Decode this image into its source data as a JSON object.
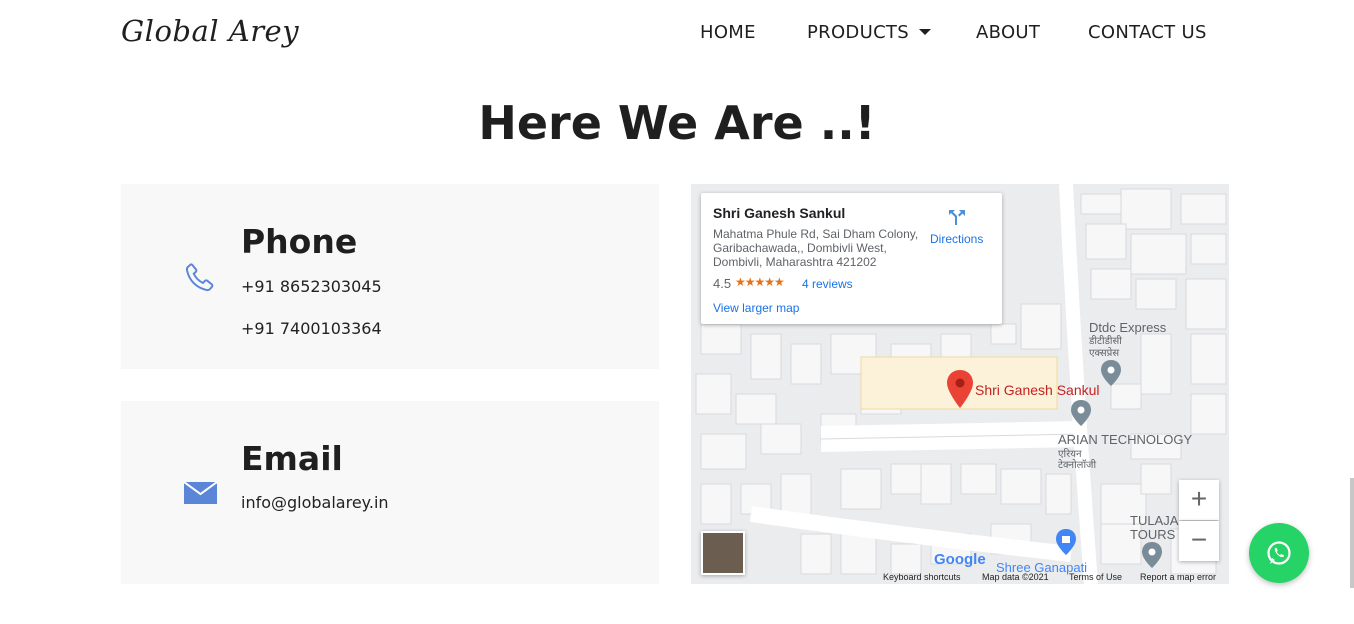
{
  "header": {
    "logo": "Global Arey",
    "nav": [
      {
        "label": "HOME"
      },
      {
        "label": "PRODUCTS"
      },
      {
        "label": "ABOUT"
      },
      {
        "label": "CONTACT US"
      }
    ]
  },
  "main": {
    "title": "Here We Are ..!",
    "phone": {
      "heading": "Phone",
      "numbers": [
        "+91 8652303045",
        "+91 7400103364"
      ],
      "icon": "phone-icon"
    },
    "email": {
      "heading": "Email",
      "address": "info@globalarey.in",
      "icon": "mail-icon"
    }
  },
  "map": {
    "place_name": "Shri Ganesh Sankul",
    "address": "Mahatma Phule Rd, Sai Dham Colony, Garibachawada,, Dombivli West, Dombivli, Maharashtra 421202",
    "rating": "4.5",
    "stars": "★★★★★",
    "reviews": "4 reviews",
    "view_larger": "View larger map",
    "directions": "Directions",
    "marker_label": "Shri Ganesh Sankul",
    "labels": {
      "dtdc": "Dtdc Express",
      "dtdc_hi1": "डीटीडीसी",
      "dtdc_hi2": "एक्सप्रेस",
      "arian": "ARIAN TECHNOLOGY",
      "arian_hi1": "एरियन",
      "arian_hi2": "टेक्नोलॉजी",
      "tulaja": "TULAJA",
      "tours": "TOURS",
      "shree": "Shree Ganapati"
    },
    "google": "Google",
    "footer": {
      "shortcuts": "Keyboard shortcuts",
      "mapdata": "Map data ©2021",
      "terms": "Terms of Use",
      "report": "Report a map error"
    },
    "zoom_in": "+",
    "zoom_out": "−"
  },
  "colors": {
    "accent_blue": "#5b86d8",
    "whatsapp_green": "#25d366",
    "marker_red": "#ea4335"
  }
}
